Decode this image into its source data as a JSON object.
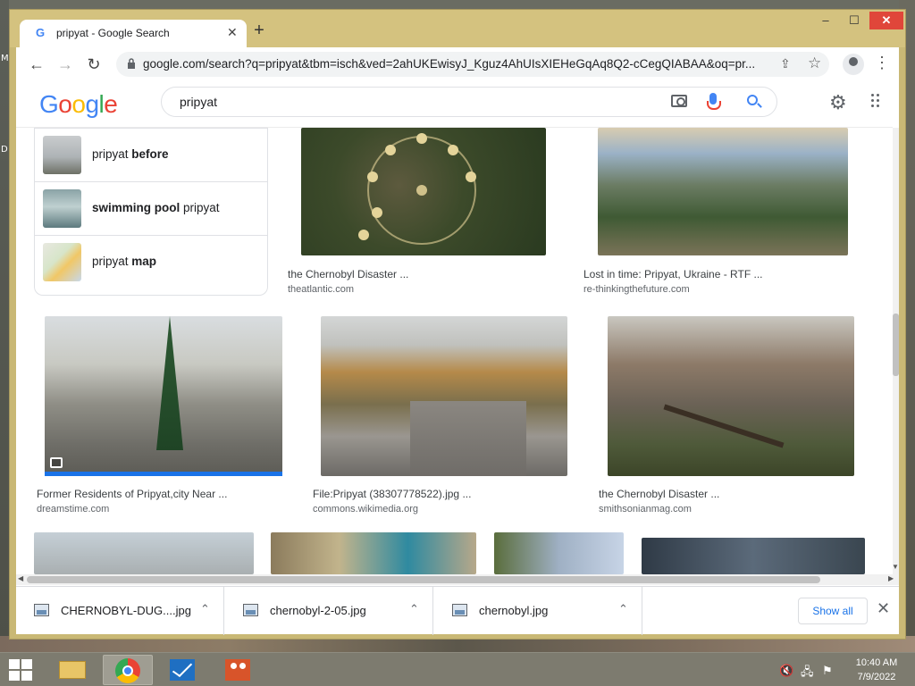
{
  "desktop": {
    "left_letters": [
      "M",
      "D"
    ]
  },
  "window": {
    "tab_title": "pripyat - Google Search",
    "favicon": "G",
    "controls": {
      "minimize": "–",
      "maximize": "☐",
      "close": "✕"
    }
  },
  "toolbar": {
    "url": "google.com/search?q=pripyat&tbm=isch&ved=2ahUKEwisyJ_Kguz4AhUIsXIEHeGqAq8Q2-cCegQIABAA&oq=pr..."
  },
  "search": {
    "logo_letters": [
      "G",
      "o",
      "o",
      "g",
      "l",
      "e"
    ],
    "logo_colors": [
      "#4285f4",
      "#ea4335",
      "#fbbc05",
      "#4285f4",
      "#34a853",
      "#ea4335"
    ],
    "query": "pripyat"
  },
  "related": [
    {
      "plain_before": "pripyat ",
      "bold": "before",
      "plain_after": ""
    },
    {
      "plain_before": "",
      "bold": "swimming pool",
      "plain_after": " pripyat"
    },
    {
      "plain_before": "pripyat ",
      "bold": "map",
      "plain_after": ""
    }
  ],
  "results": [
    {
      "caption": "the Chernobyl Disaster ...",
      "source": "theatlantic.com"
    },
    {
      "caption": "Lost in time: Pripyat, Ukraine - RTF ...",
      "source": "re-thinkingthefuture.com"
    },
    {
      "caption": "Former Residents of Pripyat,city Near ...",
      "source": "dreamstime.com"
    },
    {
      "caption": "File:Pripyat (38307778522).jpg ...",
      "source": "commons.wikimedia.org"
    },
    {
      "caption": "the Chernobyl Disaster ...",
      "source": "smithsonianmag.com"
    }
  ],
  "downloads": {
    "items": [
      "CHERNOBYL-DUG....jpg",
      "chernobyl-2-05.jpg",
      "chernobyl.jpg"
    ],
    "show_all": "Show all"
  },
  "taskbar": {
    "time": "10:40 AM",
    "date": "7/9/2022"
  }
}
